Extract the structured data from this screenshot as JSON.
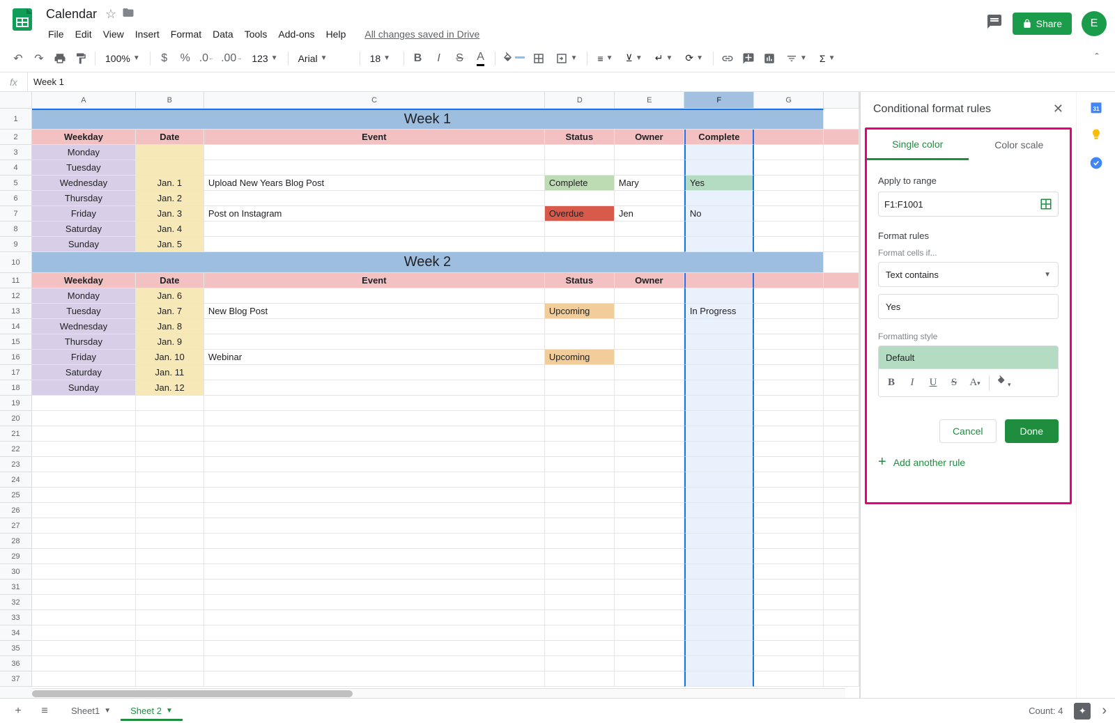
{
  "doc": {
    "title": "Calendar",
    "save_status": "All changes saved in Drive"
  },
  "menus": [
    "File",
    "Edit",
    "View",
    "Insert",
    "Format",
    "Data",
    "Tools",
    "Add-ons",
    "Help"
  ],
  "toolbar": {
    "zoom": "100%",
    "font": "Arial",
    "size": "18",
    "share": "Share"
  },
  "avatar_letter": "E",
  "formula": {
    "value": "Week 1"
  },
  "columns": [
    "A",
    "B",
    "C",
    "D",
    "E",
    "F",
    "G"
  ],
  "col_widths": {
    "A": 152,
    "B": 100,
    "C": 500,
    "D": 102,
    "E": 102,
    "F": 102,
    "G": 102,
    "H": 52
  },
  "selected_col": "F",
  "sheet": {
    "week1_title": "Week 1",
    "week2_title": "Week 2",
    "headers": {
      "weekday": "Weekday",
      "date": "Date",
      "event": "Event",
      "status": "Status",
      "owner": "Owner",
      "complete": "Complete"
    },
    "week1": [
      {
        "weekday": "Monday",
        "date": "",
        "event": "",
        "status": "",
        "owner": "",
        "complete": ""
      },
      {
        "weekday": "Tuesday",
        "date": "",
        "event": "",
        "status": "",
        "owner": "",
        "complete": ""
      },
      {
        "weekday": "Wednesday",
        "date": "Jan. 1",
        "event": "Upload New Years Blog Post",
        "status": "Complete",
        "status_class": "status-complete",
        "owner": "Mary",
        "complete": "Yes",
        "complete_class": "complete-yes"
      },
      {
        "weekday": "Thursday",
        "date": "Jan. 2",
        "event": "",
        "status": "",
        "owner": "",
        "complete": ""
      },
      {
        "weekday": "Friday",
        "date": "Jan. 3",
        "event": "Post on Instagram",
        "status": "Overdue",
        "status_class": "status-overdue",
        "owner": "Jen",
        "complete": "No"
      },
      {
        "weekday": "Saturday",
        "date": "Jan. 4",
        "event": "",
        "status": "",
        "owner": "",
        "complete": ""
      },
      {
        "weekday": "Sunday",
        "date": "Jan. 5",
        "event": "",
        "status": "",
        "owner": "",
        "complete": ""
      }
    ],
    "week2": [
      {
        "weekday": "Monday",
        "date": "Jan. 6",
        "event": "",
        "status": "",
        "owner": "",
        "complete": ""
      },
      {
        "weekday": "Tuesday",
        "date": "Jan. 7",
        "event": "New Blog Post",
        "status": "Upcoming",
        "status_class": "status-upcoming",
        "owner": "",
        "complete": "In Progress"
      },
      {
        "weekday": "Wednesday",
        "date": "Jan. 8",
        "event": "",
        "status": "",
        "owner": "",
        "complete": ""
      },
      {
        "weekday": "Thursday",
        "date": "Jan. 9",
        "event": "",
        "status": "",
        "owner": "",
        "complete": ""
      },
      {
        "weekday": "Friday",
        "date": "Jan. 10",
        "event": "Webinar",
        "status": "Upcoming",
        "status_class": "status-upcoming",
        "owner": "",
        "complete": ""
      },
      {
        "weekday": "Saturday",
        "date": "Jan. 11",
        "event": "",
        "status": "",
        "owner": "",
        "complete": ""
      },
      {
        "weekday": "Sunday",
        "date": "Jan. 12",
        "event": "",
        "status": "",
        "owner": "",
        "complete": ""
      }
    ],
    "empty_rows": 19
  },
  "panel": {
    "title": "Conditional format rules",
    "tab_single": "Single color",
    "tab_scale": "Color scale",
    "apply_label": "Apply to range",
    "range": "F1:F1001",
    "rules_label": "Format rules",
    "cells_if": "Format cells if...",
    "condition": "Text contains",
    "value": "Yes",
    "style_label": "Formatting style",
    "style_name": "Default",
    "cancel": "Cancel",
    "done": "Done",
    "add_rule": "Add another rule"
  },
  "bottom": {
    "sheets": [
      {
        "name": "Sheet1",
        "active": false
      },
      {
        "name": "Sheet 2",
        "active": true
      }
    ],
    "count": "Count: 4"
  }
}
